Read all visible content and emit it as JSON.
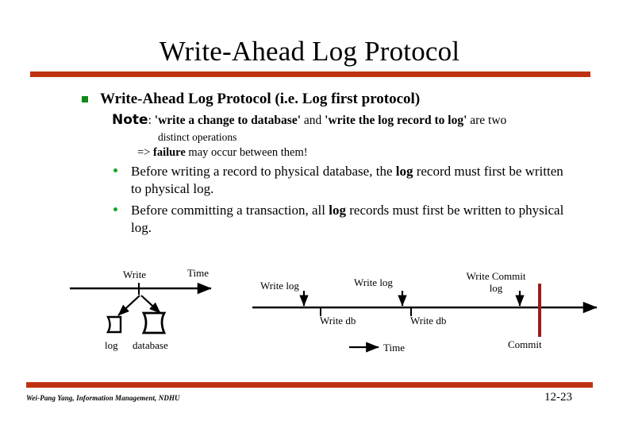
{
  "slide": {
    "title": "Write-Ahead Log Protocol",
    "accent_color": "#bf3210",
    "bullet_color": "#0f8a18",
    "commit_line_color": "#9e1b1b"
  },
  "bullet1": {
    "text": "Write-Ahead Log Protocol  (i.e.  Log first protocol)"
  },
  "note": {
    "label": "Note",
    "colon": ": ",
    "quote1": "'write a change to database'",
    "mid": " and ",
    "quote2": "'write the log record to log'",
    "tail": " are two",
    "line2": "distinct operations",
    "line3_arrow": "=> ",
    "line3_bold": "failure",
    "line3_rest": " may occur between them!"
  },
  "subbullets": [
    {
      "pre": "Before writing a record to physical database, the ",
      "bold": "log",
      "post": " record  must first be written to physical log."
    },
    {
      "pre": "Before committing a transaction, all ",
      "bold": "log",
      "post": " records must first be written to physical log."
    }
  ],
  "diagram_left": {
    "write_label": "Write",
    "time_label": "Time",
    "log_label": "log",
    "database_label": "database"
  },
  "diagram_right": {
    "write_log_1": "Write log",
    "write_log_2": "Write log",
    "write_commit_log_line1": "Write Commit",
    "write_commit_log_line2": "log",
    "write_db_1": "Write db",
    "write_db_2": "Write db",
    "time_label": "Time",
    "commit_label": "Commit"
  },
  "footer": {
    "credit": "Wei-Pang Yang, Information Management, NDHU",
    "page": "12-23"
  }
}
